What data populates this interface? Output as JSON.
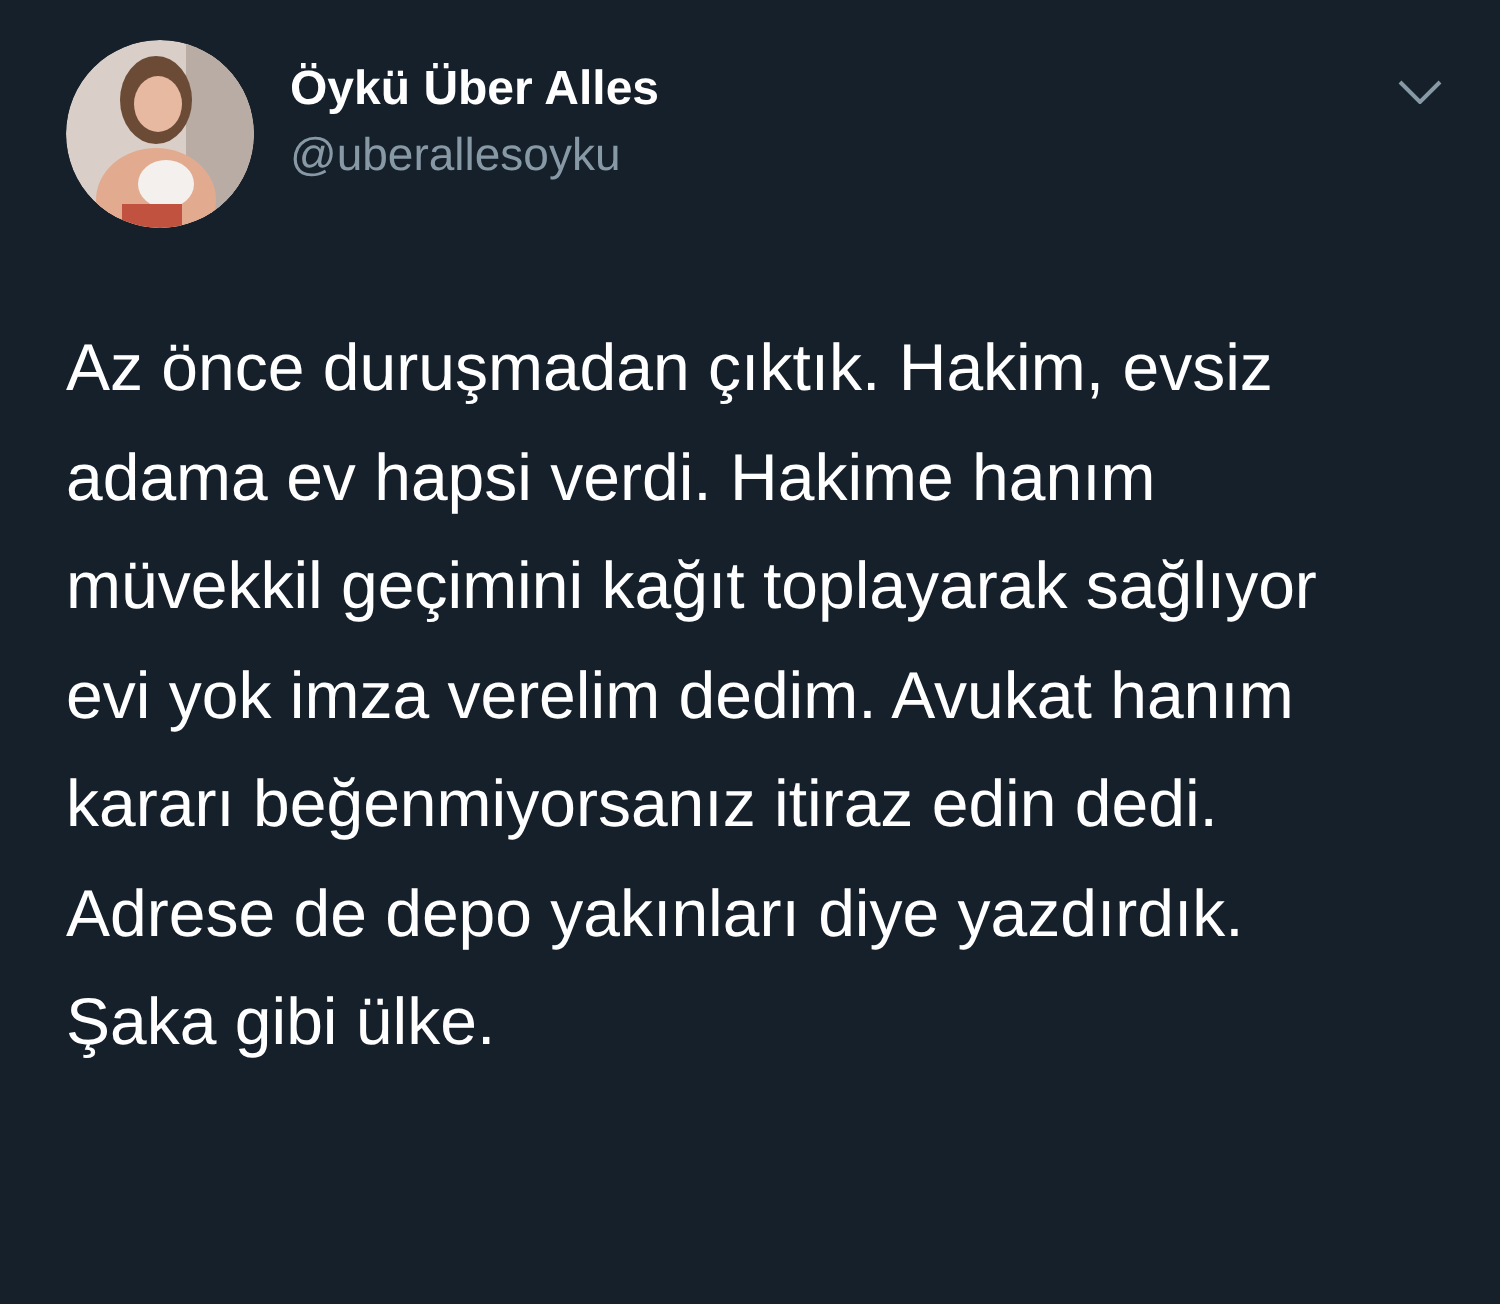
{
  "tweet": {
    "author": {
      "name": "Öykü Über Alles",
      "handle": "@uberallesoyku"
    },
    "text": "Az önce duruşmadan çıktık. Hakim, evsiz adama ev hapsi verdi. Hakime hanım müvekkil geçimini kağıt toplayarak sağlıyor evi yok imza verelim dedim. Avukat hanım kararı beğenmiyorsanız itiraz edin dedi. Adrese de depo yakınları diye yazdırdık. Şaka gibi ülke."
  }
}
